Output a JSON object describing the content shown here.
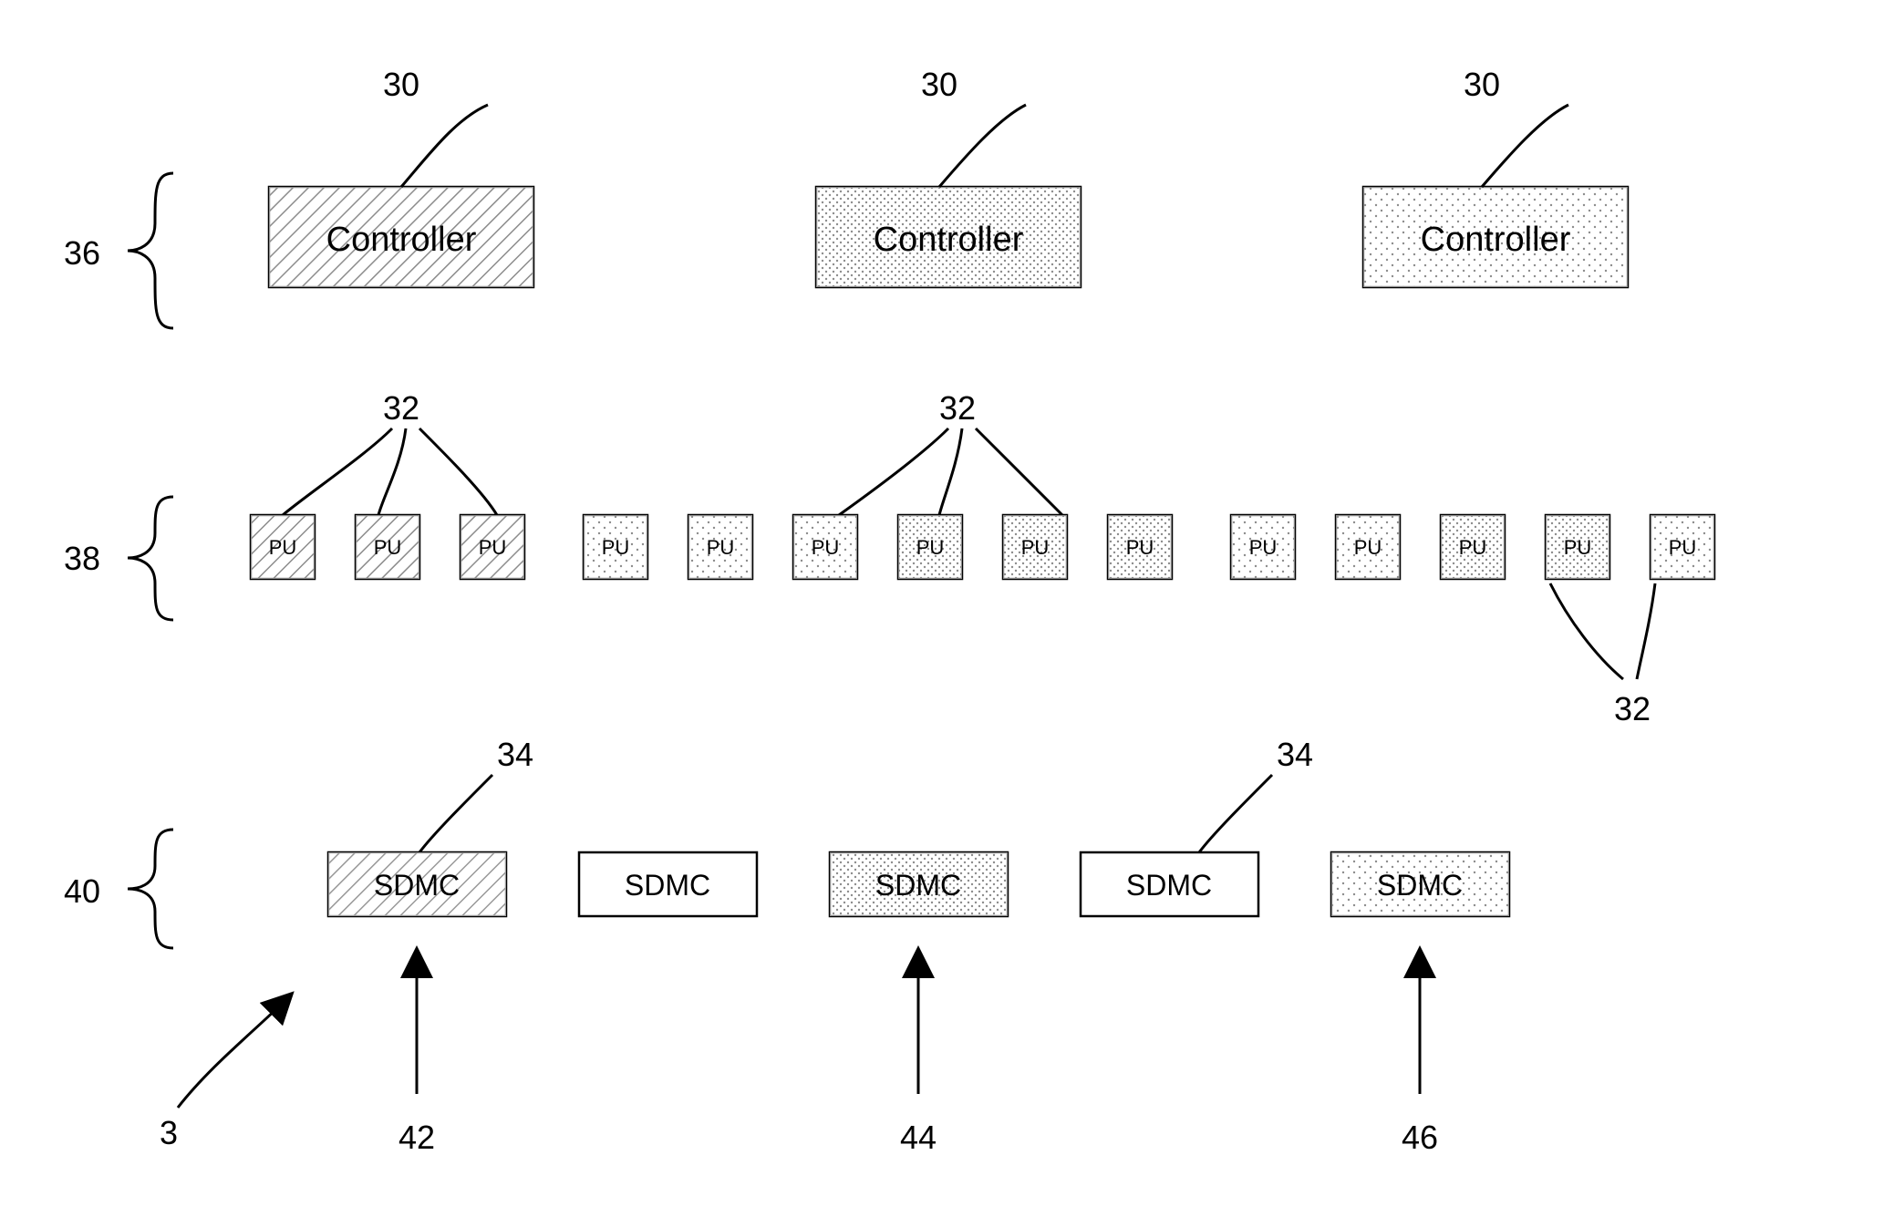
{
  "labels": {
    "ref3": "3",
    "ref30": "30",
    "ref32": "32",
    "ref34": "34",
    "ref36": "36",
    "ref38": "38",
    "ref40": "40",
    "ref42": "42",
    "ref44": "44",
    "ref46": "46"
  },
  "blocks": {
    "controller": "Controller",
    "pu": "PU",
    "sdmc": "SDMC"
  }
}
